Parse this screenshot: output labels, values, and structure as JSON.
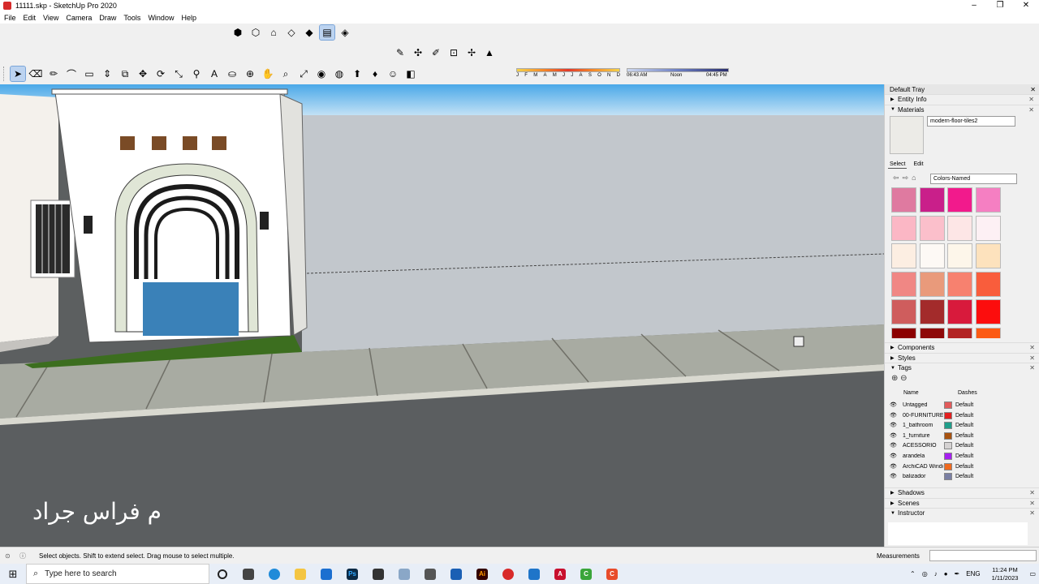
{
  "window": {
    "title": "11111.skp - SketchUp Pro 2020",
    "controls": {
      "minimize": "–",
      "maximize": "❐",
      "close": "✕"
    }
  },
  "menu": [
    "File",
    "Edit",
    "View",
    "Camera",
    "Draw",
    "Tools",
    "Window",
    "Help"
  ],
  "shadow_settings": {
    "months": [
      "J",
      "F",
      "M",
      "A",
      "M",
      "J",
      "J",
      "A",
      "S",
      "O",
      "N",
      "D"
    ],
    "time_start": "06:43 AM",
    "time_noon": "Noon",
    "time_end": "04:45 PM"
  },
  "viewport": {
    "watermark": "م فراس جراد"
  },
  "tray": {
    "title": "Default Tray",
    "sections": {
      "entity_info": "Entity Info",
      "materials": "Materials",
      "components": "Components",
      "styles": "Styles",
      "tags": "Tags",
      "shadows": "Shadows",
      "scenes": "Scenes",
      "instructor": "Instructor"
    },
    "materials": {
      "current_name": "modern-floor-tiles2",
      "tab_select": "Select",
      "tab_edit": "Edit",
      "library": "Colors-Named",
      "swatch_colors": [
        "#df7aa0",
        "#c91f8a",
        "#f21a8c",
        "#f57fc2",
        "#fbb7c5",
        "#fbbfcb",
        "#fde6e6",
        "#fdf0f4",
        "#fceee2",
        "#fdf9f5",
        "#fdf6ea",
        "#fde2bd",
        "#f08784",
        "#e99a7b",
        "#f7816f",
        "#f95d3c",
        "#cf5d5d",
        "#a32b2b",
        "#d81a3c",
        "#fc0d0d",
        "#8c0000",
        "#8e0808",
        "#b32424",
        "#fc5a14"
      ]
    },
    "tags": {
      "col_name": "Name",
      "col_dashes": "Dashes",
      "rows": [
        {
          "name": "Untagged",
          "color": "#e25b5b",
          "dashes": "Default"
        },
        {
          "name": "00-FURNITURE",
          "color": "#e21f1f",
          "dashes": "Default"
        },
        {
          "name": "1_bathroom",
          "color": "#1f9e8a",
          "dashes": "Default"
        },
        {
          "name": "1_furniture",
          "color": "#a8520f",
          "dashes": "Default"
        },
        {
          "name": "ACESSORIO",
          "color": "#d5d2d2",
          "dashes": "Default"
        },
        {
          "name": "arandela",
          "color": "#a61ff0",
          "dashes": "Default"
        },
        {
          "name": "ArchiCAD Windo",
          "color": "#f06a1f",
          "dashes": "Default"
        },
        {
          "name": "balizador",
          "color": "#7a7fa3",
          "dashes": "Default"
        }
      ]
    }
  },
  "status": {
    "message": "Select objects. Shift to extend select. Drag mouse to select multiple.",
    "measurements_label": "Measurements"
  },
  "taskbar": {
    "search_placeholder": "Type here to search",
    "language": "ENG",
    "time": "11:24 PM",
    "date": "1/11/2023"
  }
}
